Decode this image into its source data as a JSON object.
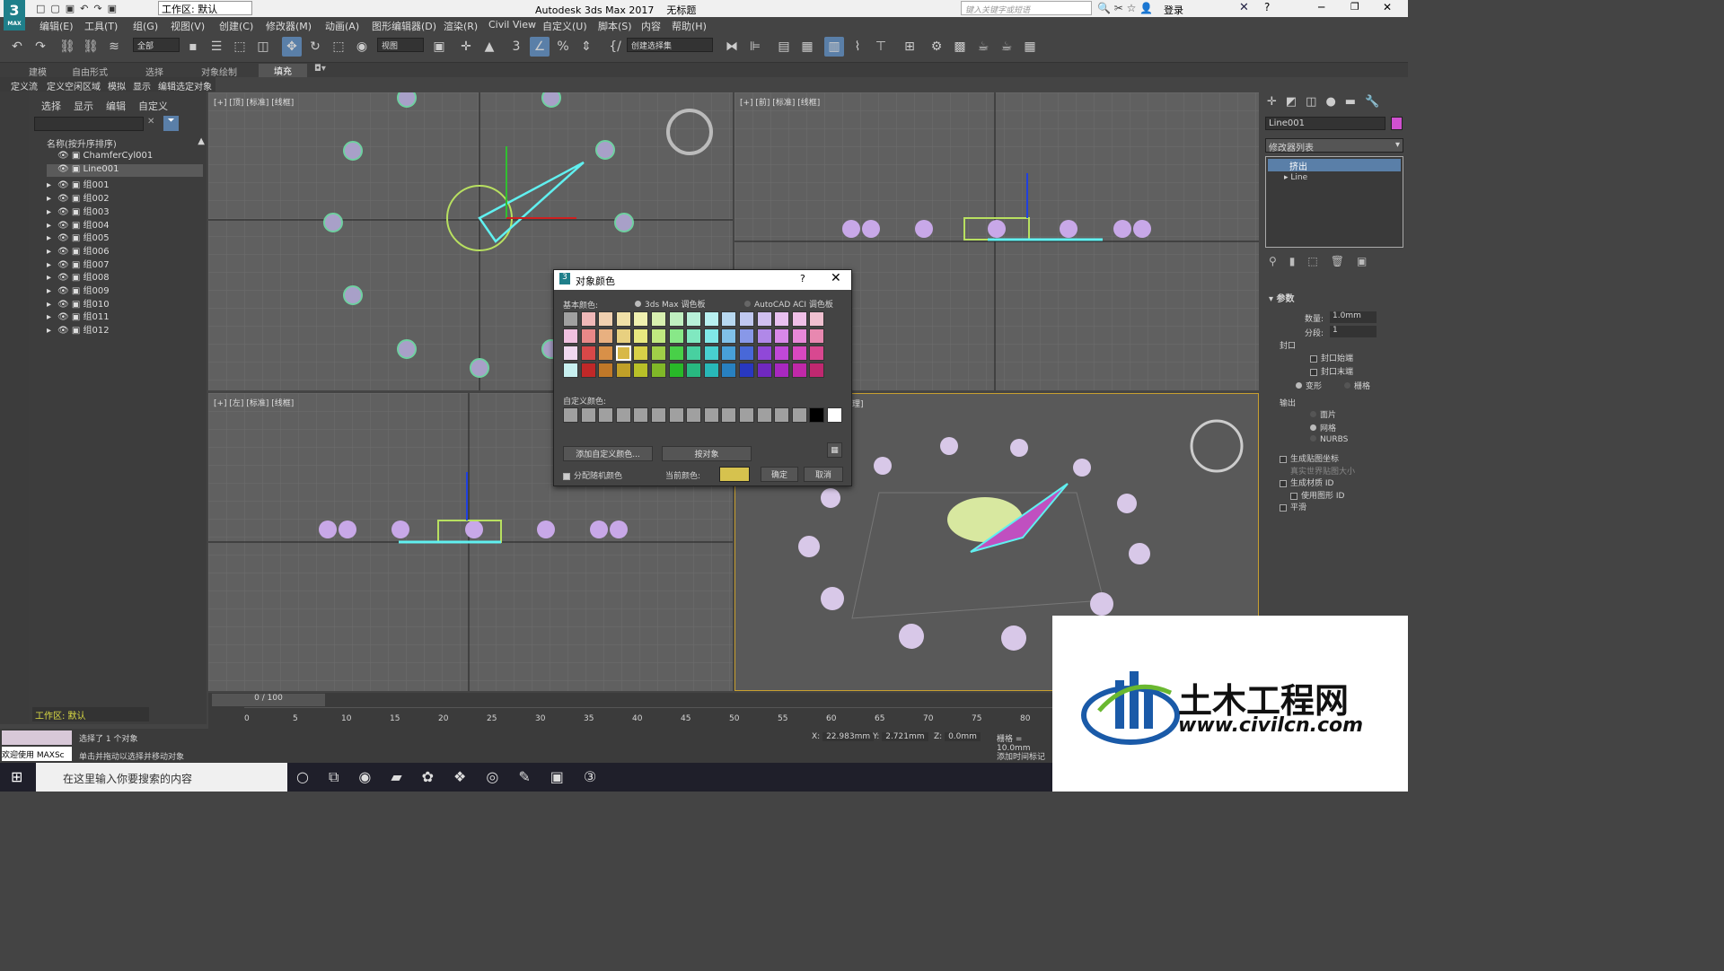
{
  "app": {
    "logo": "3",
    "logo_sub": "MAX",
    "workspace_label": "工作区: 默认",
    "title": "Autodesk 3ds Max 2017",
    "file": "无标题",
    "search_placeholder": "键入关键字或短语",
    "login": "登录"
  },
  "menu": [
    "编辑(E)",
    "工具(T)",
    "组(G)",
    "视图(V)",
    "创建(C)",
    "修改器(M)",
    "动画(A)",
    "图形编辑器(D)",
    "渲染(R)",
    "Civil View",
    "自定义(U)",
    "脚本(S)",
    "内容",
    "帮助(H)"
  ],
  "toolbar": {
    "filter": "全部",
    "ref_coord": "视图",
    "selset": "创建选择集"
  },
  "ribbon_tabs": [
    "建模",
    "自由形式",
    "选择",
    "对象绘制",
    "填充"
  ],
  "ribbon_sub": [
    "定义流",
    "定义空闲区域",
    "模拟",
    "显示",
    "编辑选定对象"
  ],
  "scene": {
    "menus": [
      "选择",
      "显示",
      "编辑",
      "自定义"
    ],
    "header": "名称(按升序排序)",
    "items": [
      "ChamferCyl001",
      "Line001",
      "组001",
      "组002",
      "组003",
      "组004",
      "组005",
      "组006",
      "组007",
      "组008",
      "组009",
      "组010",
      "组011",
      "组012"
    ]
  },
  "viewports": {
    "top": "[+] [顶] [标准] [线框]",
    "front": "[+] [前] [标准] [线框]",
    "left": "[+] [左] [标准] [线框]",
    "persp": "理]"
  },
  "dialog": {
    "icon": "3",
    "title": "对象颜色",
    "help": "?",
    "basic_label": "基本颜色:",
    "palette_max": "3ds Max 调色板",
    "palette_acad": "AutoCAD ACI 调色板",
    "custom_label": "自定义颜色:",
    "add_custom": "添加自定义颜色...",
    "by_object": "按对象",
    "random": "分配随机颜色",
    "current_label": "当前颜色:",
    "current_color": "#d6c24e",
    "ok": "确定",
    "cancel": "取消"
  },
  "right_panel": {
    "object_name": "Line001",
    "object_color": "#d050d0",
    "modifier_list": "修改器列表",
    "stack": [
      "挤出",
      "Line"
    ],
    "rollout": "参数",
    "amount_label": "数量:",
    "amount": "1.0mm",
    "segments_label": "分段:",
    "segments": "1",
    "capping": "封口",
    "cap_start": "封口始端",
    "cap_end": "封口末端",
    "morph": "变形",
    "grid": "栅格",
    "output": "输出",
    "patch": "面片",
    "mesh": "网格",
    "nurbs": "NURBS",
    "gen_map": "生成贴图坐标",
    "real_world": "真实世界贴图大小",
    "gen_mat": "生成材质 ID",
    "use_shape": "使用图形 ID",
    "smooth": "平滑"
  },
  "timeline": {
    "frame": "0 / 100",
    "ticks": [
      "0",
      "5",
      "10",
      "15",
      "20",
      "25",
      "30",
      "35",
      "40",
      "45",
      "50",
      "55",
      "60",
      "65",
      "70",
      "75",
      "80"
    ]
  },
  "status": {
    "workspace": "工作区: 默认",
    "welcome": "欢迎使用 MAXSc",
    "selected": "选择了 1 个对象",
    "hint": "单击并拖动以选择并移动对象",
    "x_label": "X:",
    "x": "22.983mm",
    "y_label": "Y:",
    "y": "2.721mm",
    "z_label": "Z:",
    "z": "0.0mm",
    "grid": "栅格 = 10.0mm",
    "add_tag": "添加时间标记"
  },
  "taskbar": {
    "search": "在这里输入你要搜索的内容"
  },
  "watermark": {
    "brand": "土木工程网",
    "url": "www.civilcn.com"
  }
}
